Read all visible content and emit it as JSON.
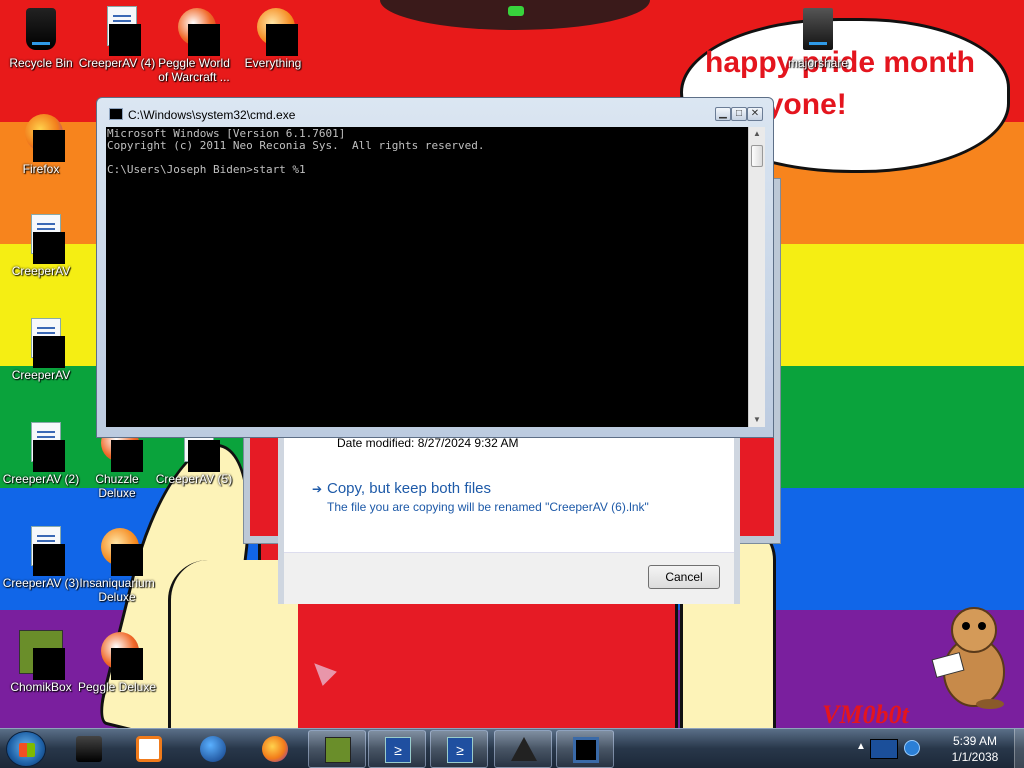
{
  "wallpaper": {
    "bubble_text": "happy pride month everyone!",
    "watermark": "VM0b0t",
    "stripe_colors": [
      "#e81a1a",
      "#f7841d",
      "#f5ee13",
      "#0aa33c",
      "#1166e8",
      "#7a1f9e"
    ]
  },
  "desktop_icons": [
    {
      "label": "Recycle Bin",
      "icon": "recycle-bin-icon"
    },
    {
      "label": "CreeperAV (4)",
      "icon": "document-icon"
    },
    {
      "label": "Peggle World of Warcraft ...",
      "icon": "peggle-icon"
    },
    {
      "label": "Everything",
      "icon": "everything-search-icon"
    },
    {
      "label": "majorshare",
      "icon": "archive-icon"
    },
    {
      "label": "Firefox",
      "icon": "firefox-icon"
    },
    {
      "label": "CreeperAV",
      "icon": "document-icon"
    },
    {
      "label": "CreeperAV",
      "icon": "document-icon"
    },
    {
      "label": "CreeperAV (2)",
      "icon": "document-icon"
    },
    {
      "label": "Chuzzle Deluxe",
      "icon": "chuzzle-icon"
    },
    {
      "label": "CreeperAV (5)",
      "icon": "document-icon"
    },
    {
      "label": "CreeperAV (3)",
      "icon": "document-icon"
    },
    {
      "label": "Insaniquarium Deluxe",
      "icon": "insaniquarium-icon"
    },
    {
      "label": "ChomikBox",
      "icon": "chomikbox-icon"
    },
    {
      "label": "Peggle Deluxe",
      "icon": "peggle-icon"
    }
  ],
  "cmd_window": {
    "title": "C:\\Windows\\system32\\cmd.exe",
    "console_text": "Microsoft Windows [Version 6.1.7601]\nCopyright (c) 2011 Neo Reconia Sys.  All rights reserved.\n\nC:\\Users\\Joseph Biden>start %1",
    "minimize_glyph": "▁",
    "maximize_glyph": "□",
    "close_glyph": "✕"
  },
  "copy_dialog": {
    "date_modified": "Date modified: 8/27/2024 9:32 AM",
    "option_title": "Copy, but keep both files",
    "option_description": "The file you are copying will be renamed \"CreeperAV (6).lnk\"",
    "option_arrow": "➔",
    "cancel_label": "Cancel"
  },
  "taskbar": {
    "pinned": [
      {
        "name": "device-manager-icon",
        "running": false
      },
      {
        "name": "media-player-icon",
        "running": false
      },
      {
        "name": "globe-icon",
        "running": false
      },
      {
        "name": "firefox-icon",
        "running": false
      },
      {
        "name": "chomikbox-icon",
        "running": true
      },
      {
        "name": "powershell-icon",
        "running": true
      },
      {
        "name": "powershell-icon",
        "running": true
      },
      {
        "name": "warning-icon",
        "running": true
      },
      {
        "name": "cmd-icon",
        "running": true
      }
    ],
    "ps_glyph": "≥",
    "tray_chevron": "▲",
    "clock_time": "5:39 AM",
    "clock_date": "1/1/2038"
  }
}
